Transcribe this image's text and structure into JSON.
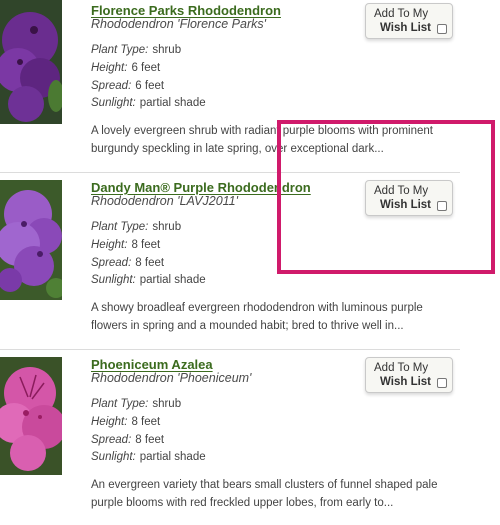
{
  "wishlist": {
    "line1": "Add To My",
    "line2": "Wish List"
  },
  "labels": {
    "plant_type": "Plant Type:",
    "height": "Height:",
    "spread": "Spread:",
    "sunlight": "Sunlight:"
  },
  "plants": [
    {
      "name": "Florence Parks Rhododendron",
      "botanical": "Rhododendron 'Florence Parks'",
      "plant_type": "shrub",
      "height": "6 feet",
      "spread": "6 feet",
      "sunlight": "partial shade",
      "description_line1": "A lovely evergreen shrub with radiant purple blooms with prominent",
      "description_line2": "burgundy speckling in late spring, over exceptional dark...",
      "flower_color": "#6a2d8f"
    },
    {
      "name": "Dandy Man® Purple Rhododendron",
      "botanical": "Rhododendron 'LAVJ2011'",
      "plant_type": "shrub",
      "height": "8 feet",
      "spread": "8 feet",
      "sunlight": "partial shade",
      "description_line1": "A showy broadleaf evergreen rhododendron with luminous purple",
      "description_line2": "flowers in spring and a mounded habit; bred to thrive well in...",
      "flower_color": "#8a49b8"
    },
    {
      "name": "Phoeniceum Azalea",
      "botanical": "Rhododendron 'Phoeniceum'",
      "plant_type": "shrub",
      "height": "8 feet",
      "spread": "8 feet",
      "sunlight": "partial shade",
      "description_line1": "An evergreen variety that bears small clusters of funnel shaped pale",
      "description_line2": "purple blooms with red freckled upper lobes, from early to...",
      "flower_color": "#d456a8"
    }
  ],
  "colors": {
    "title_green": "#3b6b1e",
    "highlight": "#d01a6b"
  }
}
